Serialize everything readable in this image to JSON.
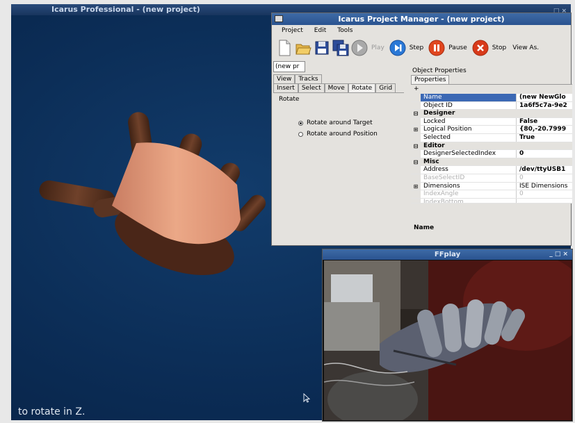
{
  "viewport": {
    "title": "Icarus Professional - (new project)",
    "title_controls": "_ □ ×",
    "hint": "to rotate in Z."
  },
  "project_manager": {
    "title": "Icarus Project Manager - (new project)",
    "menu": [
      "Project",
      "Edit",
      "Tools"
    ],
    "toolbar": {
      "play": "Play",
      "step": "Step",
      "pause": "Pause",
      "stop": "Stop",
      "view_as": "View As."
    },
    "combo_value": "(new pr",
    "tabs_row1": [
      "View",
      "Tracks"
    ],
    "tabs_row2": [
      "Insert",
      "Select",
      "Move",
      "Rotate",
      "Grid"
    ],
    "rotate_panel": {
      "heading": "Rotate",
      "option_target": "Rotate around Target",
      "option_position": "Rotate around Position"
    },
    "object_properties": {
      "title": "Object Properties",
      "tab": "Properties",
      "toolbar_plus": "+",
      "description_name": "Name",
      "rows": [
        {
          "name": "Name",
          "value": "(new NewGlo"
        },
        {
          "name": "Object ID",
          "value": "1a6f5c7a-9e2"
        },
        {
          "name": "Designer",
          "value": ""
        },
        {
          "name": "Locked",
          "value": "False"
        },
        {
          "name": "Logical Position",
          "value": "{80,-20.7999"
        },
        {
          "name": "Selected",
          "value": "True"
        },
        {
          "name": "Editor",
          "value": ""
        },
        {
          "name": "DesignerSelectedIndex",
          "value": "0"
        },
        {
          "name": "Misc",
          "value": ""
        },
        {
          "name": "Address",
          "value": "/dev/ttyUSB1"
        },
        {
          "name": "BaseSelectID",
          "value": "0"
        },
        {
          "name": "Dimensions",
          "value": "ISE Dimensions"
        },
        {
          "name": "IndexAngle",
          "value": "0"
        },
        {
          "name": "IndexBottom",
          "value": ""
        }
      ]
    }
  },
  "ffplay": {
    "title": "FFplay",
    "controls": "_ □ ×"
  },
  "colors": {
    "viewport_bg": "#0b2c55",
    "title_bar": "#2a5390",
    "selection": "#3b68b4",
    "hand_skin": "#e0987a",
    "fingers": "#5a3422"
  }
}
